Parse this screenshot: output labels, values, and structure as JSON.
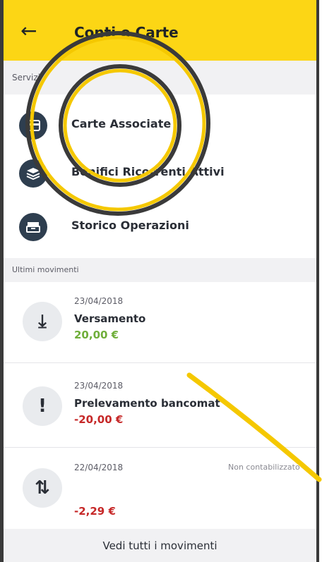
{
  "header": {
    "back_icon": "arrow-left-icon",
    "title": "Conti e Carte"
  },
  "services": {
    "section_label": "Servizi",
    "items": [
      {
        "label": "Carte Associate",
        "icon": "card-icon"
      },
      {
        "label": "Bonifici Ricorrenti Attivi",
        "icon": "stack-icon"
      },
      {
        "label": "Storico Operazioni",
        "icon": "archive-icon"
      }
    ]
  },
  "movements": {
    "section_label": "Ultimi movimenti",
    "items": [
      {
        "date": "23/04/2018",
        "description": "Versamento",
        "amount": "20,00 €",
        "status": "",
        "icon": "download-icon",
        "glyph": "⤓",
        "amount_color": "#6fae3a"
      },
      {
        "date": "23/04/2018",
        "description": "Prelevamento bancomat",
        "amount": "-20,00 €",
        "status": "",
        "icon": "exclamation-icon",
        "glyph": "!",
        "amount_color": "#c62828"
      },
      {
        "date": "22/04/2018",
        "description": "",
        "amount": "-2,29 €",
        "status": "Non contabilizzato",
        "icon": "transfer-arrows-icon",
        "glyph": "⇅",
        "amount_color": "#c62828"
      }
    ],
    "see_all_label": "Vedi tutti i movimenti"
  },
  "colors": {
    "header": "#fcd615",
    "icon_circle": "#2e3e4f",
    "positive": "#6fae3a",
    "negative": "#c62828",
    "annotation": "#f5c800"
  }
}
